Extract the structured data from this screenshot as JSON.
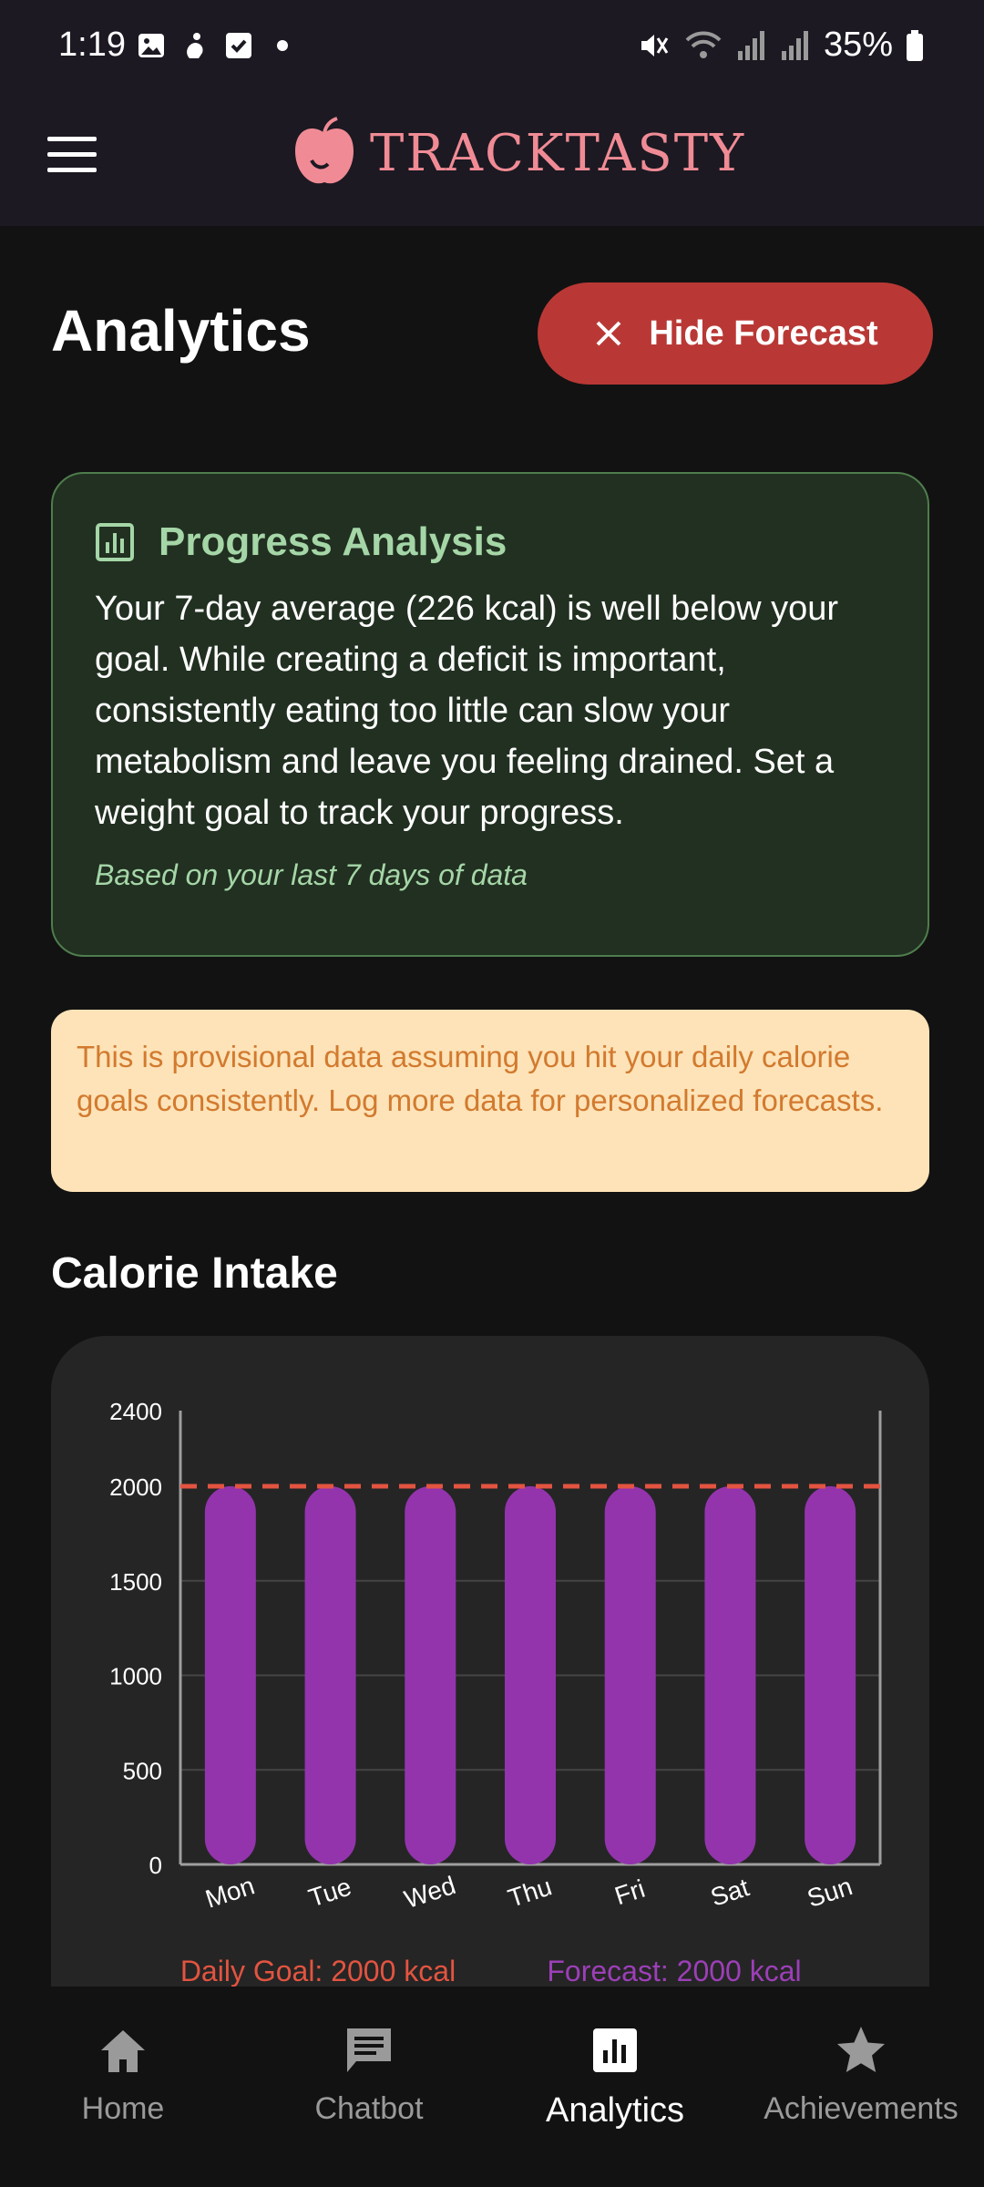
{
  "status_bar": {
    "time": "1:19",
    "battery": "35%"
  },
  "app_bar": {
    "logo_text": "TRACKTASTY",
    "brand_color": "#f08b95"
  },
  "page": {
    "title": "Analytics",
    "hide_forecast_label": "Hide Forecast"
  },
  "analysis": {
    "title": "Progress Analysis",
    "body": "Your 7-day average (226 kcal) is well below your goal. While creating a deficit is important, consistently eating too little can slow your metabolism and leave you feeling drained. Set a weight goal to track your progress.",
    "note": "Based on your last 7 days of data"
  },
  "warning": {
    "text": "This is provisional data assuming you hit your daily calorie goals consistently. Log more data for personalized forecasts."
  },
  "section": {
    "calorie_title": "Calorie Intake"
  },
  "chart_data": {
    "type": "bar",
    "categories": [
      "Mon",
      "Tue",
      "Wed",
      "Thu",
      "Fri",
      "Sat",
      "Sun"
    ],
    "values": [
      2000,
      2000,
      2000,
      2000,
      2000,
      2000,
      2000
    ],
    "goal": 2000,
    "ylim": [
      0,
      2400
    ],
    "yticks": [
      0,
      500,
      1000,
      1500,
      2000,
      2400
    ],
    "legend": [
      "Daily Goal: 2000 kcal",
      "Forecast: 2000 kcal"
    ],
    "colors": {
      "bar": "#9334ad",
      "goal": "#e35440",
      "forecast": "#9c3fb8"
    },
    "grid": true
  },
  "nav": {
    "items": [
      {
        "label": "Home",
        "icon": "home-icon"
      },
      {
        "label": "Chatbot",
        "icon": "chat-icon"
      },
      {
        "label": "Analytics",
        "icon": "analytics-icon"
      },
      {
        "label": "Achievements",
        "icon": "star-icon"
      }
    ]
  }
}
